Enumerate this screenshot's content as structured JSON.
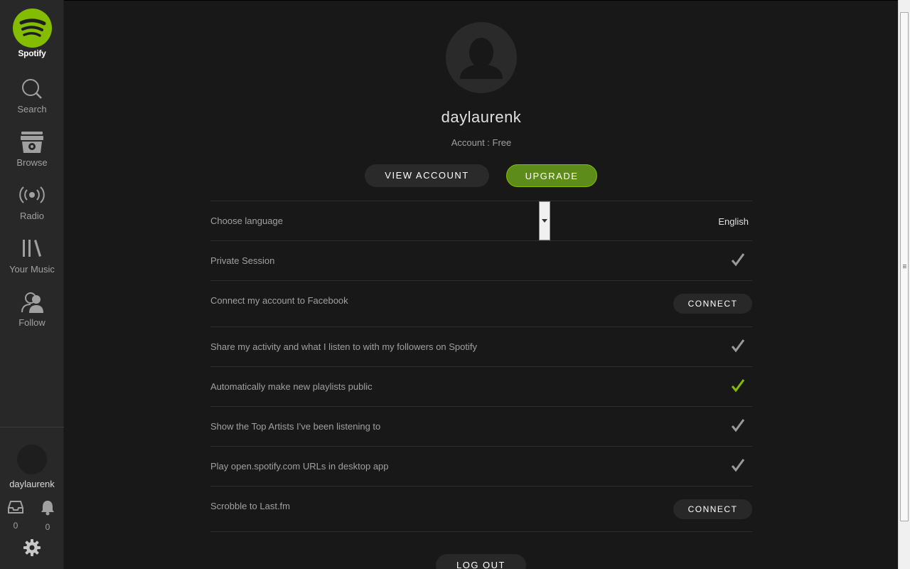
{
  "app": {
    "name": "Spotify"
  },
  "colors": {
    "brand": "#84bd00",
    "upgrade": "#5e8c1a",
    "sidebar_bg": "#282828",
    "main_bg": "#181818",
    "check_active": "#84bd00",
    "check_inactive": "#9a9a9a"
  },
  "sidebar": {
    "logo_text": "Spotify",
    "items": [
      {
        "label": "Search",
        "icon": "search-icon"
      },
      {
        "label": "Browse",
        "icon": "browse-icon"
      },
      {
        "label": "Radio",
        "icon": "radio-icon"
      },
      {
        "label": "Your Music",
        "icon": "library-icon"
      },
      {
        "label": "Follow",
        "icon": "follow-icon"
      }
    ],
    "username": "daylaurenk",
    "inbox_count": "0",
    "notifications_count": "0"
  },
  "profile": {
    "username": "daylaurenk",
    "account_type": "Account : Free",
    "view_account_label": "VIEW ACCOUNT",
    "upgrade_label": "UPGRADE"
  },
  "settings": {
    "language": {
      "label": "Choose language",
      "value": "English"
    },
    "rows": [
      {
        "label": "Private Session",
        "checked": false
      },
      {
        "label": "Connect my account to Facebook",
        "button": "CONNECT"
      },
      {
        "label": "Share my activity and what I listen to with my followers on Spotify",
        "checked": false
      },
      {
        "label": "Automatically make new playlists public",
        "checked": true
      },
      {
        "label": "Show the Top Artists I've been listening to",
        "checked": false
      },
      {
        "label": "Play open.spotify.com URLs in desktop app",
        "checked": false
      },
      {
        "label": "Scrobble to Last.fm",
        "button": "CONNECT"
      }
    ]
  },
  "logout_label": "LOG OUT"
}
